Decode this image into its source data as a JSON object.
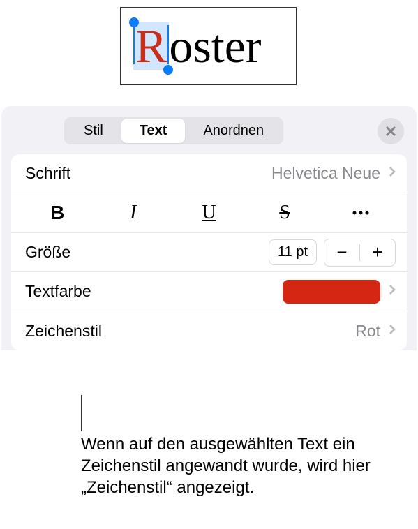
{
  "preview": {
    "selected_char": "R",
    "rest_text": "oster",
    "selected_color": "#c82f1b"
  },
  "tabs": {
    "stil": "Stil",
    "text": "Text",
    "anordnen": "Anordnen"
  },
  "rows": {
    "schrift_label": "Schrift",
    "schrift_value": "Helvetica Neue",
    "size_label": "Größe",
    "size_value": "11 pt",
    "color_label": "Textfarbe",
    "color_value": "#d52614",
    "charstyle_label": "Zeichenstil",
    "charstyle_value": "Rot"
  },
  "style_buttons": {
    "bold": "B",
    "italic": "I",
    "underline": "U",
    "strike": "S"
  },
  "stepper": {
    "minus": "−",
    "plus": "+"
  },
  "callout": "Wenn auf den ausgewählten Text ein Zeichenstil angewandt wurde, wird hier „Zeichenstil“ angezeigt."
}
